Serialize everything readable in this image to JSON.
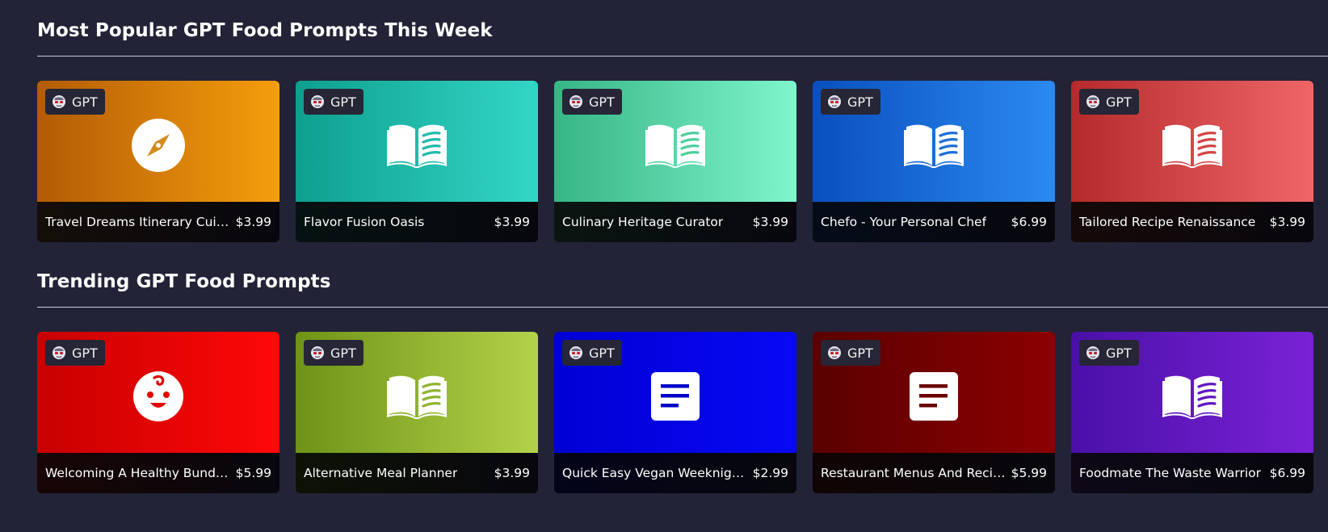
{
  "sections": [
    {
      "title": "Most Popular GPT Food Prompts This Week",
      "cards": [
        {
          "badge": "GPT",
          "icon": "compass-icon",
          "name": "Travel Dreams Itinerary Cuisine Planner",
          "price": "$3.99",
          "grad_from": "#b35b06",
          "grad_to": "#f59e0b",
          "bottom": "#150e09",
          "accent": "#d48a1c"
        },
        {
          "badge": "GPT",
          "icon": "book-open-icon",
          "name": "Flavor Fusion Oasis",
          "price": "$3.99",
          "grad_from": "#0e9f8f",
          "grad_to": "#33d6c5",
          "bottom": "#061211",
          "accent": "#20bcae"
        },
        {
          "badge": "GPT",
          "icon": "book-open-icon",
          "name": "Culinary Heritage Curator",
          "price": "$3.99",
          "grad_from": "#36b585",
          "grad_to": "#7ff5cc",
          "bottom": "#0a1511",
          "accent": "#4fcf9e"
        },
        {
          "badge": "GPT",
          "icon": "book-open-icon",
          "name": "Chefo - Your Personal Chef",
          "price": "$6.99",
          "grad_from": "#0a4fbf",
          "grad_to": "#2b8af0",
          "bottom": "#050c19",
          "accent": "#1e6fd9"
        },
        {
          "badge": "GPT",
          "icon": "book-open-icon",
          "name": "Tailored Recipe Renaissance",
          "price": "$3.99",
          "grad_from": "#b52a2a",
          "grad_to": "#f06666",
          "bottom": "#170909",
          "accent": "#d44444"
        }
      ]
    },
    {
      "title": "Trending GPT Food Prompts",
      "cards": [
        {
          "badge": "GPT",
          "icon": "baby-face-icon",
          "name": "Welcoming A Healthy Bundle Of Joy",
          "price": "$5.99",
          "grad_from": "#c70000",
          "grad_to": "#ff0808",
          "bottom": "#180505",
          "accent": "#e00000"
        },
        {
          "badge": "GPT",
          "icon": "book-open-icon",
          "name": "Alternative Meal Planner",
          "price": "$3.99",
          "grad_from": "#6e9316",
          "grad_to": "#b3d24a",
          "bottom": "#0e1206",
          "accent": "#8fb430"
        },
        {
          "badge": "GPT",
          "icon": "document-icon",
          "name": "Quick Easy Vegan Weeknight Dinners",
          "price": "$2.99",
          "grad_from": "#0000d4",
          "grad_to": "#0808f5",
          "bottom": "#04041a",
          "accent": "#0000c8"
        },
        {
          "badge": "GPT",
          "icon": "document-icon",
          "name": "Restaurant Menus And Recipes",
          "price": "$5.99",
          "grad_from": "#5a0000",
          "grad_to": "#8c0000",
          "bottom": "#110404",
          "accent": "#6b0000"
        },
        {
          "badge": "GPT",
          "icon": "book-open-icon",
          "name": "Foodmate The Waste Warrior",
          "price": "$6.99",
          "grad_from": "#4a10a8",
          "grad_to": "#7a22d6",
          "bottom": "#0e0817",
          "accent": "#6019c0"
        }
      ]
    }
  ]
}
